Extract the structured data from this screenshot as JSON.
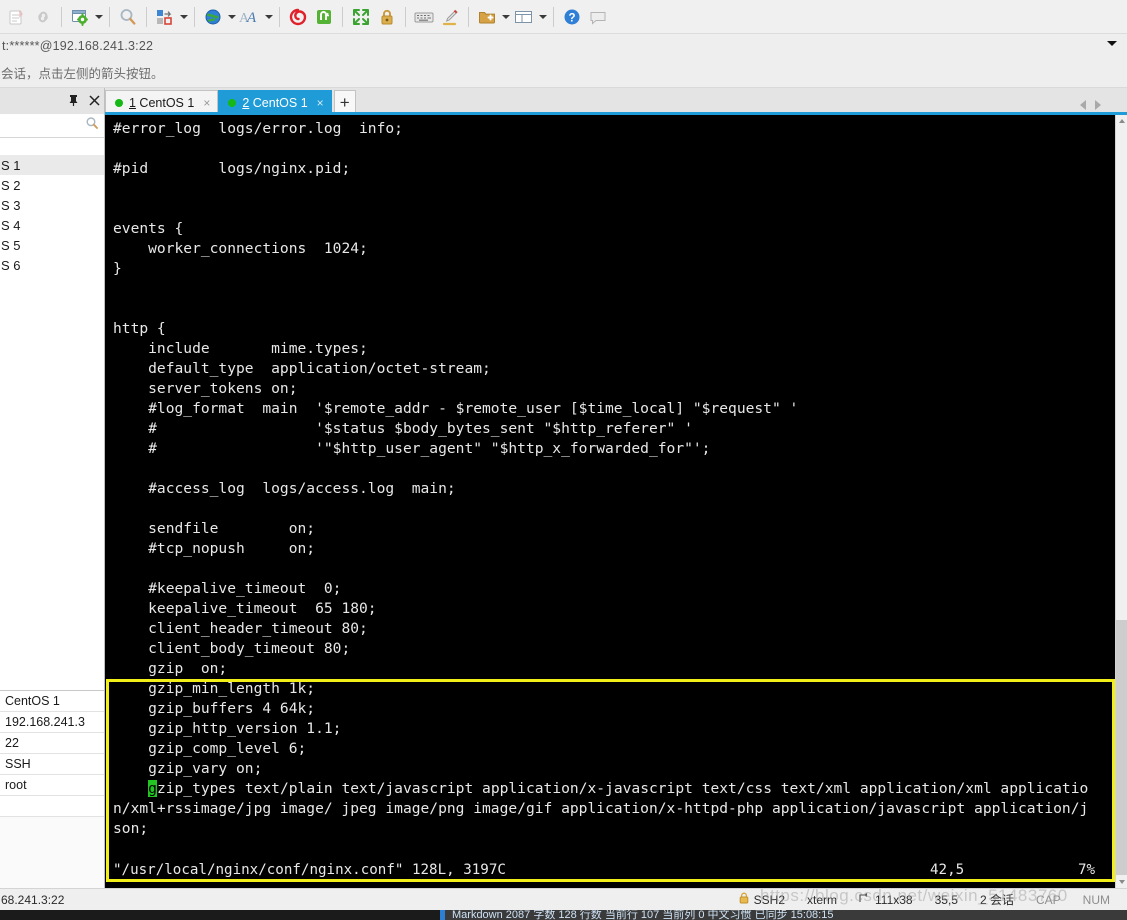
{
  "toolbar": {
    "items": [
      {
        "name": "clipboard-copy-icon",
        "caret": false
      },
      {
        "name": "link-chain-icon",
        "caret": false
      },
      {
        "name": "sep",
        "caret": false
      },
      {
        "name": "session-properties-icon",
        "caret": true
      },
      {
        "name": "sep",
        "caret": false
      },
      {
        "name": "find-search-icon",
        "caret": false
      },
      {
        "name": "sep",
        "caret": false
      },
      {
        "name": "layout-arrange-icon",
        "caret": true
      },
      {
        "name": "sep",
        "caret": false
      },
      {
        "name": "globe-web-icon",
        "caret": true
      },
      {
        "name": "font-appearance-icon",
        "caret": true
      },
      {
        "name": "sep",
        "caret": false
      },
      {
        "name": "red-spiral-icon",
        "caret": false
      },
      {
        "name": "green-transfer-icon",
        "caret": false
      },
      {
        "name": "sep",
        "caret": false
      },
      {
        "name": "fullscreen-expand-icon",
        "caret": false
      },
      {
        "name": "lock-icon",
        "caret": false
      },
      {
        "name": "sep",
        "caret": false
      },
      {
        "name": "keyboard-icon",
        "caret": false
      },
      {
        "name": "highlight-pen-icon",
        "caret": false
      },
      {
        "name": "sep",
        "caret": false
      },
      {
        "name": "new-folder-icon",
        "caret": true
      },
      {
        "name": "split-view-icon",
        "caret": true
      },
      {
        "name": "sep",
        "caret": false
      },
      {
        "name": "help-icon",
        "caret": false
      },
      {
        "name": "chat-balloon-icon",
        "caret": false
      }
    ]
  },
  "titlebar": {
    "address": "t:******@192.168.241.3:22"
  },
  "notice": {
    "text": "会话，点击左侧的箭头按钮。"
  },
  "left_panel": {
    "pin_glyph": "⊞",
    "close_glyph": "✕",
    "search_icon": "search-icon",
    "items": [
      {
        "label": "S 1",
        "selected": true
      },
      {
        "label": "S 2",
        "selected": false
      },
      {
        "label": "S 3",
        "selected": false
      },
      {
        "label": "S 4",
        "selected": false
      },
      {
        "label": "S 5",
        "selected": false
      },
      {
        "label": "S 6",
        "selected": false
      }
    ]
  },
  "properties": {
    "rows": [
      "CentOS 1",
      "192.168.241.3",
      "22",
      "SSH",
      "root",
      ""
    ]
  },
  "tabs": {
    "items": [
      {
        "num": "1",
        "label": " CentOS 1",
        "active": false,
        "close": "×"
      },
      {
        "num": "2",
        "label": " CentOS 1",
        "active": true,
        "close": "×"
      }
    ],
    "add_label": "+"
  },
  "terminal": {
    "content": "#error_log  logs/error.log  info;\n\n#pid        logs/nginx.pid;\n\n\nevents {\n    worker_connections  1024;\n}\n\n\nhttp {\n    include       mime.types;\n    default_type  application/octet-stream;\n    server_tokens on;\n    #log_format  main  '$remote_addr - $remote_user [$time_local] \"$request\" '\n    #                  '$status $body_bytes_sent \"$http_referer\" '\n    #                  '\"$http_user_agent\" \"$http_x_forwarded_for\"';\n\n    #access_log  logs/access.log  main;\n\n    sendfile        on;\n    #tcp_nopush     on;\n\n    #keepalive_timeout  0;\n    keepalive_timeout  65 180;\n    client_header_timeout 80;\n    client_body_timeout 80;\n",
    "highlighted_block_pre": "    gzip  on;\n    gzip_min_length 1k;\n    gzip_buffers 4 64k;\n    gzip_http_version 1.1;\n    gzip_comp_level 6;\n    gzip_vary on;\n    ",
    "cursor_char": "g",
    "highlighted_block_post": "zip_types text/plain text/javascript application/x-javascript text/css text/xml application/xml applicatio\nn/xml+rssimage/jpg image/ jpeg image/png image/gif application/x-httpd-php application/javascript application/j\nson;",
    "vim_file_status": "\"/usr/local/nginx/conf/nginx.conf\" 128L, 3197C",
    "vim_position": "42,5",
    "vim_percent": "7%",
    "highlight_color": "#f2ee18",
    "cursor_color": "#22c522"
  },
  "statusbar": {
    "host": "68.241.3:22",
    "protocol": "SSH2",
    "terminal_type": "xterm",
    "size": "111x38",
    "cursor": "35,5",
    "sessions": "2 会话",
    "caps": "CAP",
    "num": "NUM",
    "lock_icon": "lock-icon",
    "resize_icon": "resize-icon"
  },
  "bottom_strip": {
    "text": "Markdown  2087 字数  128 行数  当前行 107  当前列 0  中文习惯  已同步  15:08:15"
  },
  "watermark": {
    "text": "https://blog.csdn.net/weixin_51483760"
  }
}
